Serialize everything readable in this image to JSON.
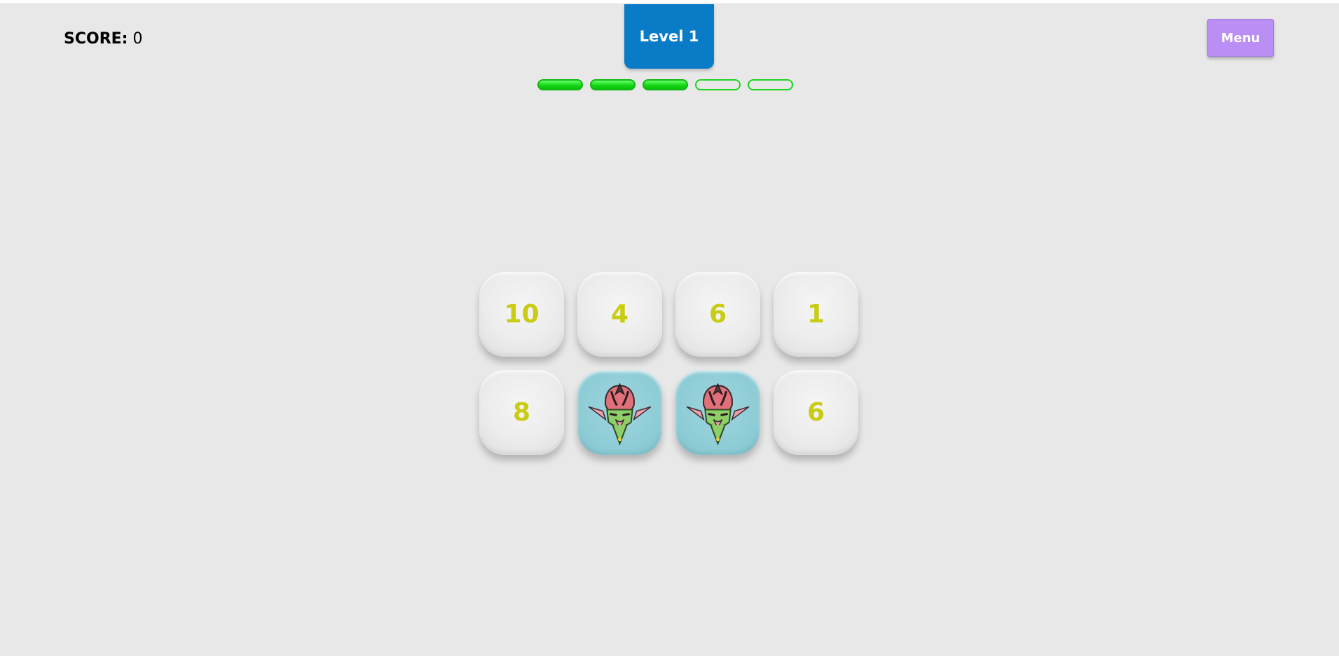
{
  "header": {
    "score_label": "SCORE:",
    "score_value": "0",
    "level_label": "Level 1",
    "menu_label": "Menu"
  },
  "progress": {
    "filled": 3,
    "total": 5,
    "pips": [
      true,
      true,
      true,
      false,
      false
    ]
  },
  "board": {
    "rows": 2,
    "cols": 4,
    "cards": [
      {
        "label": "10",
        "state": "number"
      },
      {
        "label": "4",
        "state": "number"
      },
      {
        "label": "6",
        "state": "number"
      },
      {
        "label": "1",
        "state": "number"
      },
      {
        "label": "8",
        "state": "number"
      },
      {
        "label": "",
        "state": "revealed",
        "icon": "goblin-mask-icon"
      },
      {
        "label": "",
        "state": "revealed",
        "icon": "goblin-mask-icon"
      },
      {
        "label": "6",
        "state": "number"
      }
    ]
  },
  "colors": {
    "background": "#e8e8e8",
    "level_tab": "#0a7cc7",
    "menu_button": "#bb8ef5",
    "progress_green": "#15d615",
    "card_number": "#c9cc12",
    "card_revealed": "#8ccbd5"
  }
}
